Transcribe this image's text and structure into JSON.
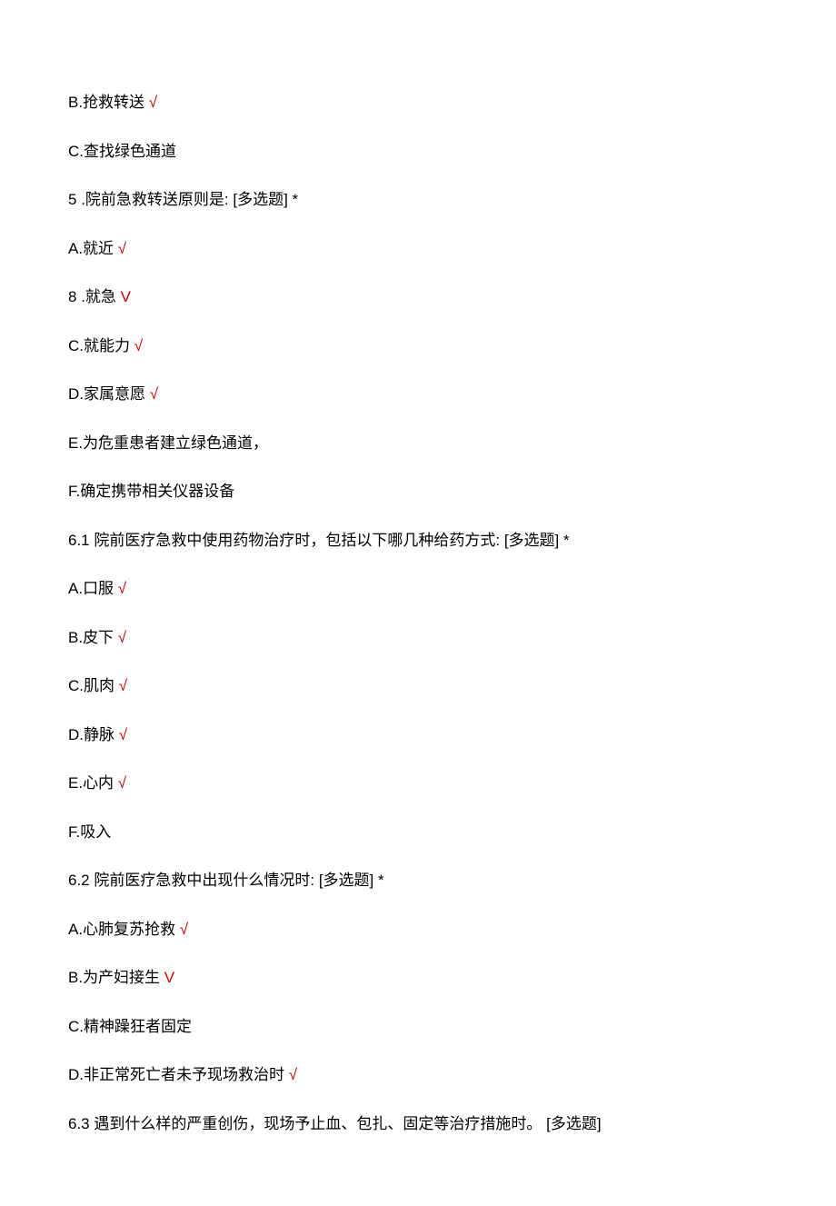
{
  "lines": [
    {
      "type": "option",
      "label": "B.",
      "text": "抢救转送",
      "mark": "√"
    },
    {
      "type": "option",
      "label": "C.",
      "text": "查找绿色通道",
      "mark": ""
    },
    {
      "type": "question",
      "num": "5",
      "sep": "  .",
      "text": "院前急救转送原则是:  [多选题]  *"
    },
    {
      "type": "option",
      "label": "A.",
      "text": "就近",
      "mark": "√"
    },
    {
      "type": "question",
      "num": "8",
      "sep": "   .",
      "text": "就急",
      "trailMark": "V"
    },
    {
      "type": "option",
      "label": "C.",
      "text": "就能力",
      "mark": "√"
    },
    {
      "type": "option",
      "label": "D.",
      "text": "家属意愿",
      "mark": "√"
    },
    {
      "type": "option",
      "label": "E.",
      "text": "为危重患者建立绿色通道，",
      "mark": ""
    },
    {
      "type": "option",
      "label": "F.",
      "text": "确定携带相关仪器设备",
      "mark": ""
    },
    {
      "type": "question",
      "num": "6.1",
      "sep": "   ",
      "text": "院前医疗急救中使用药物治疗时，包括以下哪几种给药方式:  [多选题]  *"
    },
    {
      "type": "option",
      "label": "A.",
      "text": "口服",
      "mark": "√"
    },
    {
      "type": "option",
      "label": "B.",
      "text": "皮下",
      "mark": "√"
    },
    {
      "type": "option",
      "label": "C.",
      "text": "肌肉",
      "mark": "√"
    },
    {
      "type": "option",
      "label": "D.",
      "text": "静脉",
      "mark": "√"
    },
    {
      "type": "option",
      "label": "E.",
      "text": "心内",
      "mark": "√"
    },
    {
      "type": "option",
      "label": "F.",
      "text": "吸入",
      "mark": ""
    },
    {
      "type": "question",
      "num": "6.2",
      "sep": "   ",
      "text": "院前医疗急救中出现什么情况时:  [多选题]  *"
    },
    {
      "type": "option",
      "label": "A.",
      "text": "心肺复苏抢救",
      "mark": "√"
    },
    {
      "type": "option",
      "label": "B.",
      "text": "为产妇接生",
      "mark": "V",
      "markType": "v"
    },
    {
      "type": "option",
      "label": "C.",
      "text": "精神躁狂者固定",
      "mark": ""
    },
    {
      "type": "option",
      "label": "D.",
      "text": "非正常死亡者未予现场救治时",
      "mark": "√"
    },
    {
      "type": "question",
      "num": "6.3",
      "sep": "   ",
      "text": "遇到什么样的严重创伤，现场予止血、包扎、固定等治疗措施时。  [多选题]"
    }
  ]
}
